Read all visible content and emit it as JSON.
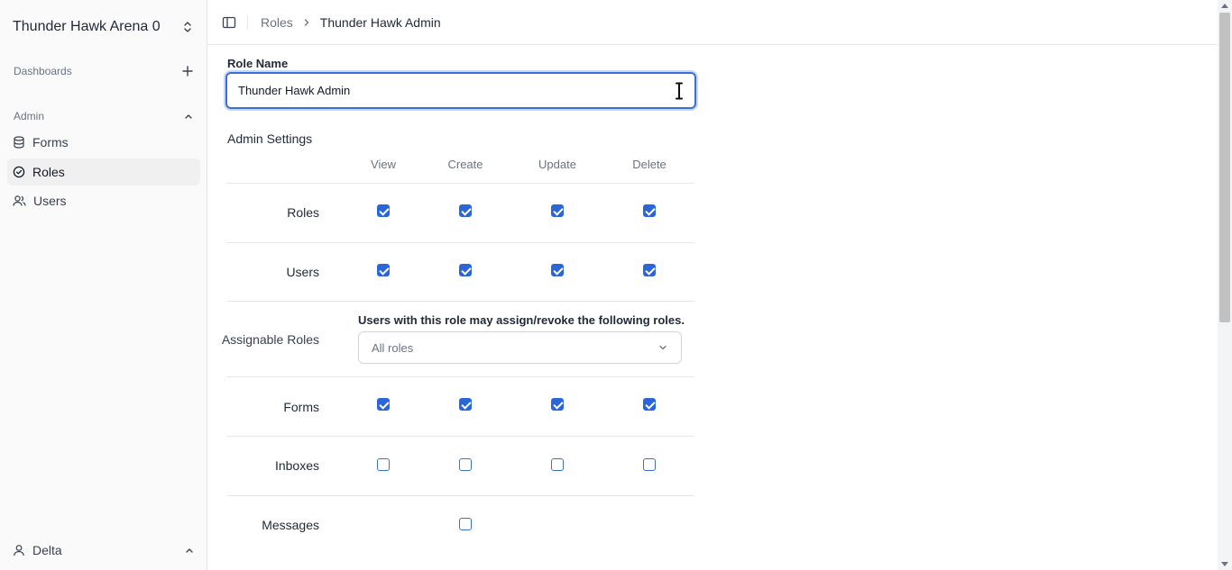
{
  "sidebar": {
    "workspace_name": "Thunder Hawk Arena 0",
    "dashboards_label": "Dashboards",
    "admin_label": "Admin",
    "items": [
      {
        "label": "Forms",
        "icon": "database-icon"
      },
      {
        "label": "Roles",
        "icon": "check-circle-icon",
        "active": true
      },
      {
        "label": "Users",
        "icon": "users-icon"
      }
    ],
    "user_name": "Delta"
  },
  "breadcrumb": {
    "parent": "Roles",
    "current": "Thunder Hawk Admin"
  },
  "form": {
    "role_name_label": "Role Name",
    "role_name_value": "Thunder Hawk Admin",
    "settings_title": "Admin Settings",
    "columns": [
      "View",
      "Create",
      "Update",
      "Delete"
    ],
    "rows": [
      {
        "label": "Roles",
        "checks": [
          true,
          true,
          true,
          true
        ]
      },
      {
        "label": "Users",
        "checks": [
          true,
          true,
          true,
          true
        ]
      },
      {
        "label": "Assignable Roles",
        "note": "Users with this role may assign/revoke the following roles.",
        "select_value": "All roles"
      },
      {
        "label": "Forms",
        "checks": [
          true,
          true,
          true,
          true
        ]
      },
      {
        "label": "Inboxes",
        "checks": [
          false,
          false,
          false,
          false
        ]
      },
      {
        "label": "Messages",
        "checks": [
          null,
          false,
          null,
          null
        ]
      }
    ]
  },
  "colors": {
    "accent": "#2b66d9",
    "sidebar_bg": "#fafafa",
    "active_item_bg": "#f0f0f1"
  }
}
